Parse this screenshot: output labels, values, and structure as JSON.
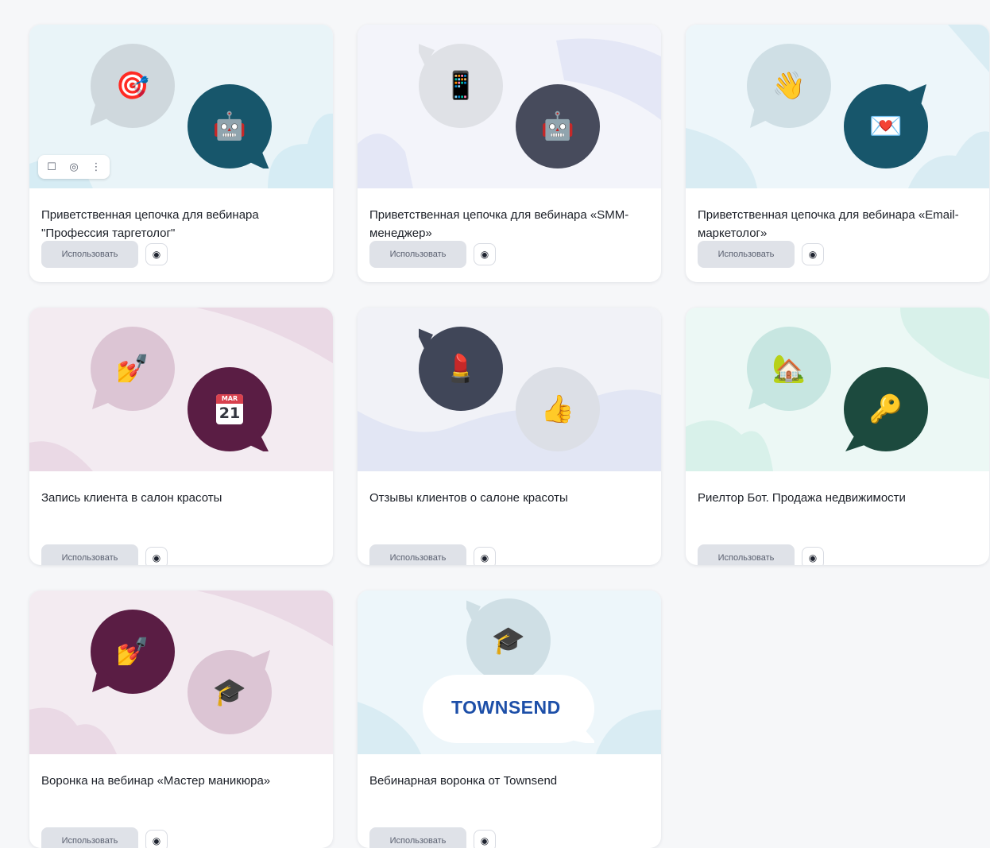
{
  "use_label": "Использовать",
  "cards": [
    {
      "title": "Приветственная цепочка для вебинара \"Профессия таргетолог\"",
      "bubble_a": {
        "icon": "target-icon",
        "glyph": "🎯",
        "color": "#cfd8dd"
      },
      "bubble_b": {
        "icon": "robot-icon",
        "glyph": "🤖",
        "color": "#17566b"
      },
      "bg": "#e9f4f8",
      "toolbar": true
    },
    {
      "title": "Приветственная цепочка для вебинара «SMM-менеджер»",
      "bubble_a": {
        "icon": "phone-hand-icon",
        "glyph": "📱",
        "color": "#dfe1e6"
      },
      "bubble_b": {
        "icon": "robot-icon",
        "glyph": "🤖",
        "color": "#474b5c"
      },
      "bg": "#eef0f8"
    },
    {
      "title": "Приветственная цепочка для вебинара «Email-маркетолог»",
      "bubble_a": {
        "icon": "waving-hand-icon",
        "glyph": "👋",
        "color": "#cfdfe5"
      },
      "bubble_b": {
        "icon": "love-letter-icon",
        "glyph": "💌",
        "color": "#17566b"
      },
      "bg": "#e9f4f8"
    },
    {
      "title": "Запись клиента в салон красоты",
      "bubble_a": {
        "icon": "nail-polish-icon",
        "glyph": "💅",
        "color": "#dcc5d4"
      },
      "bubble_b": {
        "icon": "calendar-icon",
        "glyph": "📅",
        "color": "#5a1d44"
      },
      "bg": "#f1e6ee",
      "calendar_text": [
        "MAR",
        "21"
      ]
    },
    {
      "title": "Отзывы клиентов о салоне красоты",
      "bubble_a": {
        "icon": "lipstick-icon",
        "glyph": "💄",
        "color": "#404658"
      },
      "bubble_b": {
        "icon": "thumbs-up-icon",
        "glyph": "👍",
        "color": "#dcdfe6"
      },
      "bg": "#eef0f6"
    },
    {
      "title": "Риелтор Бот. Продажа недвижимости",
      "bubble_a": {
        "icon": "house-icon",
        "glyph": "🏡",
        "color": "#c7e6e1"
      },
      "bubble_b": {
        "icon": "key-icon",
        "glyph": "🔑",
        "color": "#1c4a3e"
      },
      "bg": "#e8f7f3"
    },
    {
      "title": "Воронка на вебинар «Мастер маникюра»",
      "bubble_a": {
        "icon": "nail-polish-icon",
        "glyph": "💅",
        "color": "#5a1d44"
      },
      "bubble_b": {
        "icon": "graduation-cap-icon",
        "glyph": "🎓",
        "color": "#dcc5d4"
      },
      "bg": "#f1e6ee"
    },
    {
      "title": "Вебинарная воронка от Townsend",
      "bubble_a": {
        "icon": "graduation-cap-icon",
        "glyph": "🎓",
        "color": "#cfdfe5"
      },
      "bg": "#e9f4f8",
      "logo_text": "TOWNSEND"
    }
  ],
  "toolbar_icons": [
    "bookmark-icon",
    "camera-icon",
    "more-icon"
  ]
}
